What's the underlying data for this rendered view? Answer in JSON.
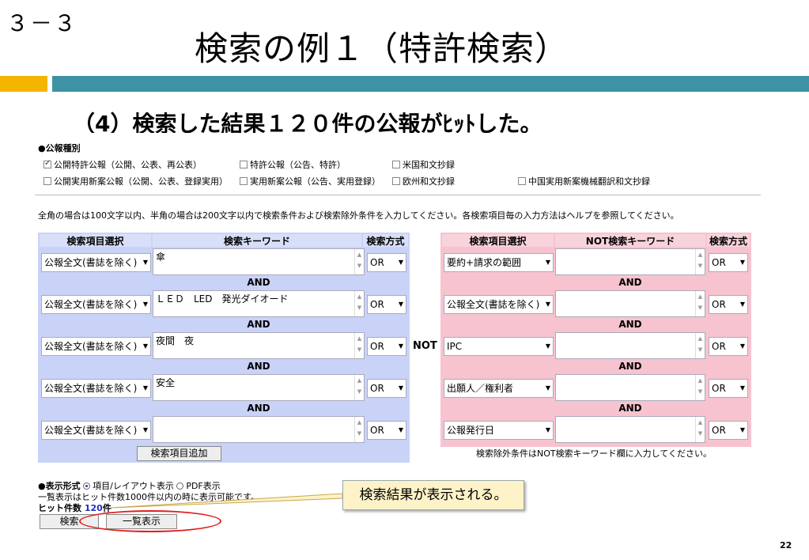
{
  "slide": {
    "section_number": "３－３",
    "title": "検索の例１（特許検索）",
    "subtitle": "（4）検索した結果１２０件の公報がﾋｯﾄした。",
    "page_number": "22",
    "accent_colors": {
      "orange": "#f5b400",
      "teal": "#3d93a3",
      "highlight_ellipse": "#e02020"
    }
  },
  "publication_types": {
    "heading": "●公報種別",
    "options": [
      {
        "label": "公開特許公報（公開、公表、再公表）",
        "checked": true
      },
      {
        "label": "特許公報（公告、特許）",
        "checked": false
      },
      {
        "label": "米国和文抄録",
        "checked": false
      },
      {
        "label": "公開実用新案公報（公開、公表、登録実用）",
        "checked": false
      },
      {
        "label": "実用新案公報（公告、実用登録）",
        "checked": false
      },
      {
        "label": "欧州和文抄録",
        "checked": false
      },
      {
        "label": "中国実用新案機械翻訳和文抄録",
        "checked": false
      }
    ]
  },
  "instruction": "全角の場合は100文字以内、半角の場合は200文字以内で検索条件および検索除外条件を入力してください。各検索項目毎の入力方法はヘルプを参照してください。",
  "search_panel": {
    "headers": {
      "item": "検索項目選択",
      "keyword": "検索キーワード",
      "method": "検索方式"
    },
    "rows": [
      {
        "item": "公報全文(書誌を除く)",
        "keyword": "傘",
        "method": "OR"
      },
      {
        "item": "公報全文(書誌を除く)",
        "keyword": "ＬＥＤ　LED　発光ダイオード",
        "method": "OR"
      },
      {
        "item": "公報全文(書誌を除く)",
        "keyword": "夜間　夜",
        "method": "OR"
      },
      {
        "item": "公報全文(書誌を除く)",
        "keyword": "安全",
        "method": "OR"
      },
      {
        "item": "公報全文(書誌を除く)",
        "keyword": "",
        "method": "OR"
      }
    ],
    "and_label": "AND",
    "add_button": "検索項目追加"
  },
  "not_label": "NOT",
  "exclude_panel": {
    "headers": {
      "item": "検索項目選択",
      "keyword": "NOT検索キーワード",
      "method": "検索方式"
    },
    "rows": [
      {
        "item": "要約+請求の範囲",
        "keyword": "",
        "method": "OR"
      },
      {
        "item": "公報全文(書誌を除く)",
        "keyword": "",
        "method": "OR"
      },
      {
        "item": "IPC",
        "keyword": "",
        "method": "OR"
      },
      {
        "item": "出願人／権利者",
        "keyword": "",
        "method": "OR"
      },
      {
        "item": "公報発行日",
        "keyword": "",
        "method": "OR"
      }
    ],
    "and_label": "AND",
    "note": "検索除外条件はNOT検索キーワード欄に入力してください。"
  },
  "display_format": {
    "heading": "●表示形式",
    "option_layout": "項目/レイアウト表示",
    "option_pdf": "PDF表示",
    "note": "一覧表示はヒット件数1000件以内の時に表示可能です。",
    "hit_label": "ヒット件数",
    "hit_count": "120",
    "hit_suffix": "件",
    "search_button": "検索",
    "list_button": "一覧表示"
  },
  "callout": "検索結果が表示される。"
}
